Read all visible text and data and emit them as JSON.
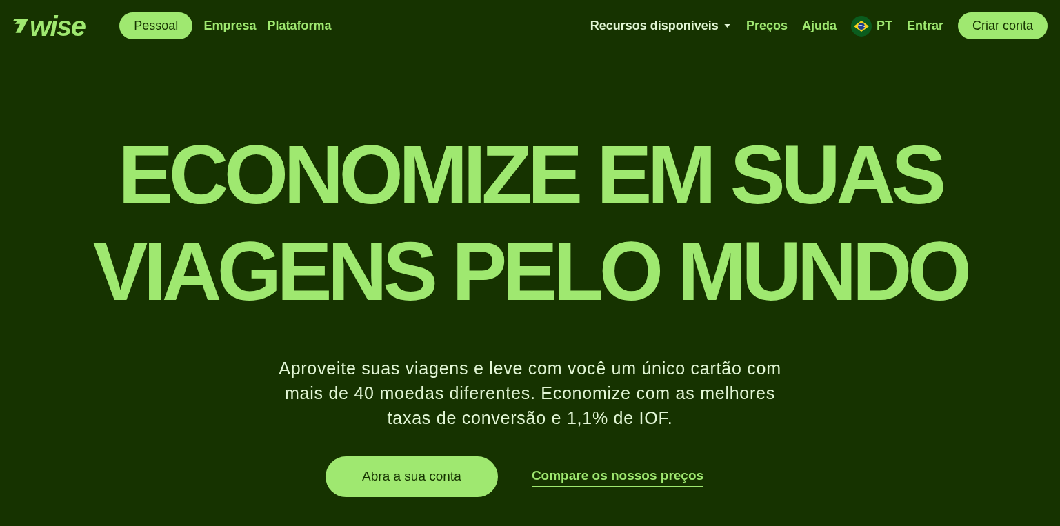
{
  "header": {
    "logo": {
      "text": "wise"
    },
    "tabs": [
      {
        "label": "Pessoal",
        "selected": true
      },
      {
        "label": "Empresa",
        "selected": false
      },
      {
        "label": "Plataforma",
        "selected": false
      }
    ],
    "nav": [
      {
        "label": "Recursos disponíveis",
        "kind": "dropdown"
      },
      {
        "label": "Preços",
        "kind": "link"
      },
      {
        "label": "Ajuda",
        "kind": "link"
      },
      {
        "label": "PT",
        "kind": "language"
      },
      {
        "label": "Entrar",
        "kind": "link"
      }
    ],
    "cta": "Criar conta"
  },
  "hero": {
    "headline": "ECONOMIZE EM SUAS VIAGENS PELO MUNDO",
    "description": "Aproveite suas viagens e leve com você um único cartão com mais de 40 moedas diferentes. Economize com as melhores taxas de conversão e 1,1% de IOF.",
    "primary_button": "Abra a sua conta",
    "secondary_link": "Compare os nossos preços"
  }
}
